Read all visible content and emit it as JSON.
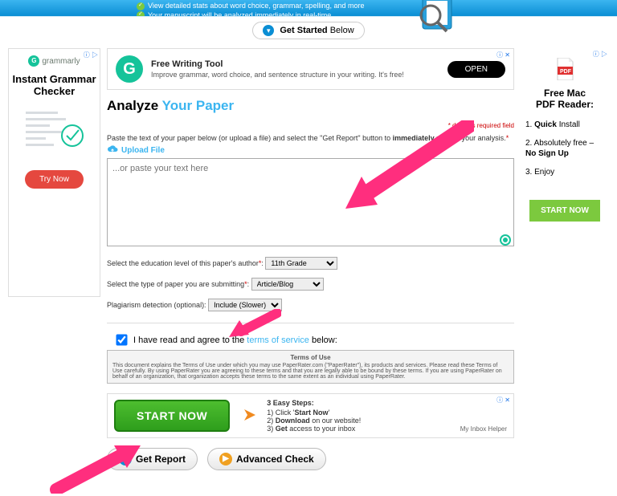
{
  "header": {
    "bullets": [
      "View detailed stats about word choice, grammar, spelling, and more",
      "Your manuscript will be analyzed immediately in real-time"
    ],
    "get_started_label": "Get Started",
    "get_started_suffix": "Below"
  },
  "left_ad": {
    "brand": "grammarly",
    "headline": "Instant Grammar Checker",
    "cta": "Try Now"
  },
  "top_ad": {
    "title": "Free Writing Tool",
    "body": "Improve grammar, word choice, and sentence structure in your writing. It's free!",
    "cta": "OPEN"
  },
  "analyze": {
    "title_prefix": "Analyze",
    "title_suffix": "Your Paper",
    "required_note": "* denotes required field",
    "instruction_pre": "Paste the text of your paper below (or upload a file) and select the \"Get Report\" button to ",
    "instruction_bold": "immediately",
    "instruction_post": " receive your analysis.",
    "upload_label": "Upload File",
    "placeholder": "...or paste your text here",
    "edu_label": "Select the education level of this paper's author",
    "edu_value": "11th Grade",
    "type_label": "Select the type of paper you are submitting",
    "type_value": "Article/Blog",
    "plag_label": "Plagiarism detection (optional):",
    "plag_value": "Include (Slower)",
    "terms_agree_pre": "I have read and agree to the ",
    "terms_agree_link": "terms of service",
    "terms_agree_post": " below:",
    "terms_title": "Terms of Use",
    "terms_body": "This document explains the Terms of Use under which you may use PaperRater.com (\"PaperRater\"), its products and services. Please read these Terms of Use carefully. By using PaperRater you are agreeing to these terms and that you are legally able to be bound by these terms. If you are using PaperRater on behalf of an organization, that organization accepts these terms to the same extent as an individual using PaperRater."
  },
  "start_ad": {
    "cta": "START NOW",
    "steps_title": "3 Easy Steps:",
    "step1_pre": "1) Click '",
    "step1_bold": "Start Now",
    "step1_post": "'",
    "step2_pre": "2) ",
    "step2_bold": "Download",
    "step2_post": " on our website!",
    "step3_pre": "3) ",
    "step3_bold": "Get",
    "step3_post": " access to your inbox",
    "sponsor": "My Inbox Helper"
  },
  "actions": {
    "get_report": "Get Report",
    "advanced_check": "Advanced Check"
  },
  "right_ad": {
    "headline_1": "Free Mac",
    "headline_2": "PDF Reader:",
    "items": [
      {
        "pre": "1. ",
        "bold": "Quick",
        "post": " Install"
      },
      {
        "pre": "2. Absolutely free – ",
        "bold": "No Sign Up",
        "post": ""
      },
      {
        "pre": "3. Enjoy",
        "bold": "",
        "post": ""
      }
    ],
    "cta": "START NOW"
  }
}
